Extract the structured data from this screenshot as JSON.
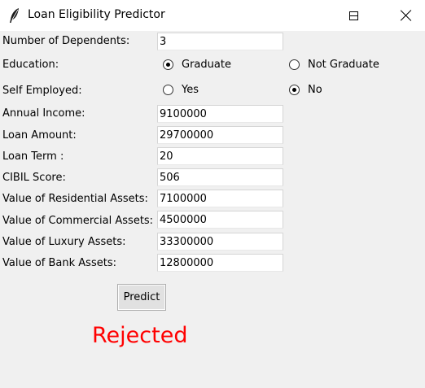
{
  "window": {
    "title": "Loan Eligibility Predictor",
    "icon": "feather-icon"
  },
  "form": {
    "dependents": {
      "label": "Number of Dependents:",
      "value": "3"
    },
    "education": {
      "label": "Education:",
      "options": [
        "Graduate",
        "Not Graduate"
      ],
      "selected": "Graduate"
    },
    "self_employed": {
      "label": "Self Employed:",
      "options": [
        "Yes",
        "No"
      ],
      "selected": "No"
    },
    "annual_income": {
      "label": "Annual Income:",
      "value": "9100000"
    },
    "loan_amount": {
      "label": "Loan Amount:",
      "value": "29700000"
    },
    "loan_term": {
      "label": "Loan Term :",
      "value": "20"
    },
    "cibil_score": {
      "label": "CIBIL Score:",
      "value": "506"
    },
    "residential_assets": {
      "label": "Value of Residential Assets:",
      "value": "7100000"
    },
    "commercial_assets": {
      "label": "Value of Commercial Assets:",
      "value": "4500000"
    },
    "luxury_assets": {
      "label": "Value of Luxury Assets:",
      "value": "33300000"
    },
    "bank_assets": {
      "label": "Value of Bank Assets:",
      "value": "12800000"
    }
  },
  "predict_button": {
    "label": "Predict"
  },
  "result": {
    "text": "Rejected",
    "color": "#ff0000"
  }
}
